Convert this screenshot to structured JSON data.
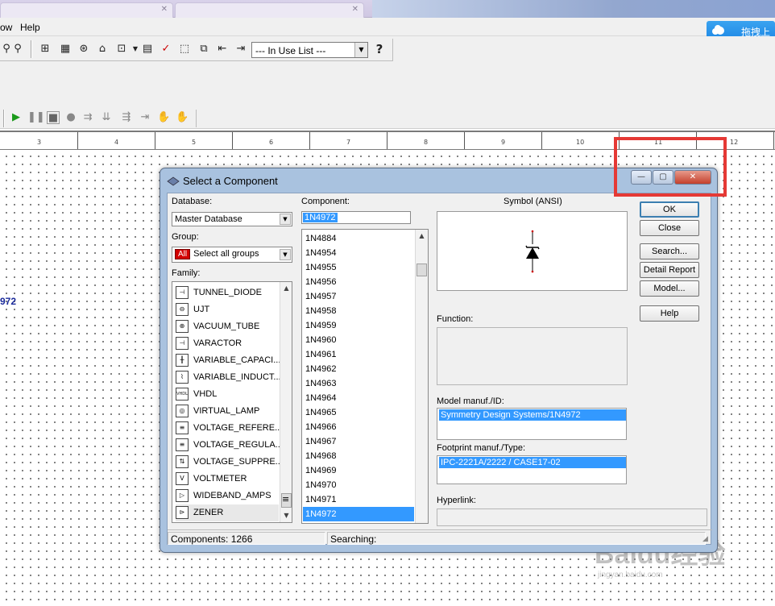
{
  "menubar": {
    "view_partial": "ow",
    "help": "Help"
  },
  "cloud_button": {
    "label": "拖拽上传"
  },
  "toolbar": {
    "in_use_list": "--- In Use List ---",
    "help_icon": "?"
  },
  "canvas": {
    "part_label": "972",
    "ruler_numbers": [
      "3",
      "4",
      "5",
      "6",
      "7",
      "8",
      "9",
      "10",
      "11",
      "12"
    ]
  },
  "watermark": {
    "brand": "Baidu经验",
    "url": "jingyan.baidu.com"
  },
  "dialog": {
    "title": "Select a Component",
    "window_buttons": {
      "minimize": "—",
      "maximize": "▢",
      "close": "✕"
    },
    "database_label": "Database:",
    "database_value": "Master Database",
    "group_label": "Group:",
    "group_badge": "All",
    "group_value": "Select all groups",
    "family_label": "Family:",
    "families": [
      {
        "icon": "tunnel-diode-icon",
        "glyph": "⊣",
        "label": "TUNNEL_DIODE"
      },
      {
        "icon": "ujt-icon",
        "glyph": "⊖",
        "label": "UJT"
      },
      {
        "icon": "vacuum-tube-icon",
        "glyph": "⊕",
        "label": "VACUUM_TUBE"
      },
      {
        "icon": "varactor-icon",
        "glyph": "⊣",
        "label": "VARACTOR"
      },
      {
        "icon": "variable-capacitor-icon",
        "glyph": "╫",
        "label": "VARIABLE_CAPACI..."
      },
      {
        "icon": "variable-inductor-icon",
        "glyph": "⌇",
        "label": "VARIABLE_INDUCT..."
      },
      {
        "icon": "vhdl-icon",
        "glyph": "VHDL",
        "label": "VHDL"
      },
      {
        "icon": "virtual-lamp-icon",
        "glyph": "◎",
        "label": "VIRTUAL_LAMP"
      },
      {
        "icon": "voltage-reference-icon",
        "glyph": "≡",
        "label": "VOLTAGE_REFERE..."
      },
      {
        "icon": "voltage-regulator-icon",
        "glyph": "≡",
        "label": "VOLTAGE_REGULA..."
      },
      {
        "icon": "voltage-suppressor-icon",
        "glyph": "⇅",
        "label": "VOLTAGE_SUPPRE..."
      },
      {
        "icon": "voltmeter-icon",
        "glyph": "V",
        "label": "VOLTMETER"
      },
      {
        "icon": "wideband-amps-icon",
        "glyph": "▷",
        "label": "WIDEBAND_AMPS"
      },
      {
        "icon": "zener-icon",
        "glyph": "⊳",
        "label": "ZENER"
      }
    ],
    "component_label": "Component:",
    "component_value": "1N4972",
    "components": [
      "1N4884",
      "1N4954",
      "1N4955",
      "1N4956",
      "1N4957",
      "1N4958",
      "1N4959",
      "1N4960",
      "1N4961",
      "1N4962",
      "1N4963",
      "1N4964",
      "1N4965",
      "1N4966",
      "1N4967",
      "1N4968",
      "1N4969",
      "1N4970",
      "1N4971",
      "1N4972"
    ],
    "selected_component": "1N4972",
    "symbol_label": "Symbol (ANSI)",
    "function_label": "Function:",
    "model_label": "Model manuf./ID:",
    "model_value": "Symmetry Design Systems/1N4972",
    "footprint_label": "Footprint manuf./Type:",
    "footprint_value": "IPC-2221A/2222 / CASE17-02",
    "hyperlink_label": "Hyperlink:",
    "buttons": {
      "ok": "OK",
      "close": "Close",
      "search": "Search...",
      "detail_report": "Detail Report",
      "model": "Model...",
      "help": "Help"
    },
    "status_components": "Components: 1266",
    "status_searching": "Searching:"
  },
  "colors": {
    "selection": "#3399ff",
    "highlight_box": "#e53935",
    "title_bar": "#a9c2df"
  }
}
